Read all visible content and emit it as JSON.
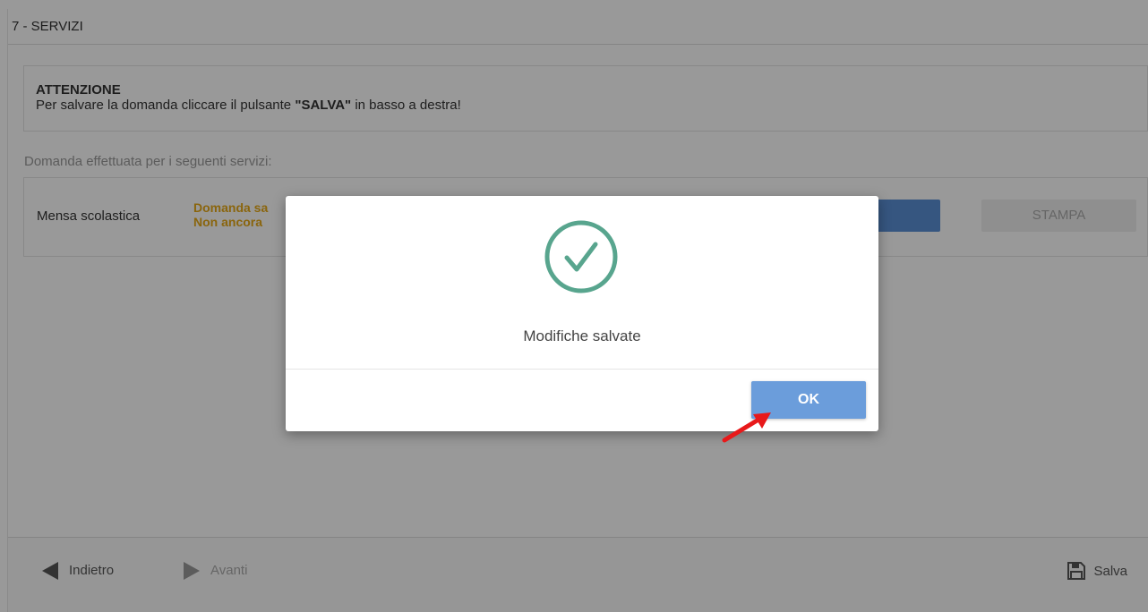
{
  "section": {
    "title": "7 - SERVIZI"
  },
  "alert": {
    "title": "ATTENZIONE",
    "text_before": "Per salvare la domanda cliccare il pulsante ",
    "text_bold": "\"SALVA\"",
    "text_after": " in basso a destra!"
  },
  "services": {
    "label": "Domanda effettuata per i seguenti servizi:",
    "rows": [
      {
        "name": "Mensa scolastica",
        "status_line1": "Domanda sa",
        "status_line2": "Non ancora",
        "print_label": "STAMPA"
      }
    ]
  },
  "footer": {
    "back_label": "Indietro",
    "next_label": "Avanti",
    "save_label": "Salva"
  },
  "modal": {
    "message": "Modifiche salvate",
    "ok_label": "OK",
    "icon": "check-circle-icon"
  },
  "colors": {
    "success": "#58a58e",
    "primary_button": "#6b9ddb",
    "status_text": "#e6a817",
    "arrow": "#e8191a"
  }
}
